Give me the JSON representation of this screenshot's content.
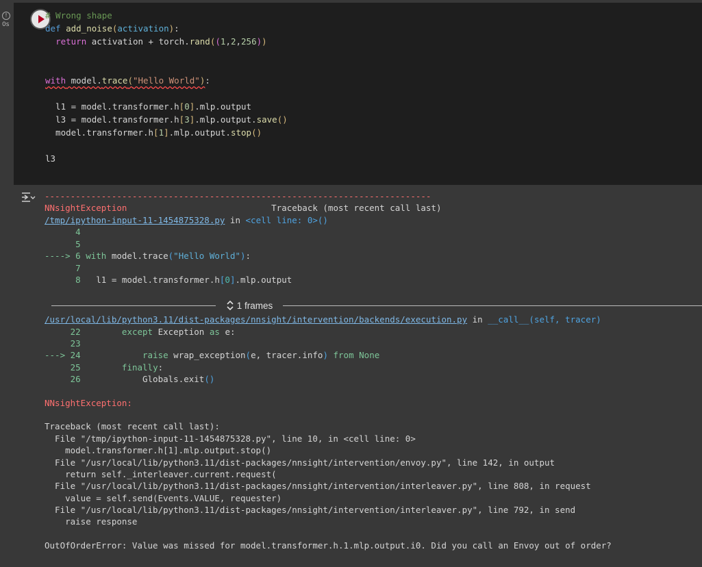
{
  "cell": {
    "status_time": "0s",
    "lines": [
      "# Wrong shape",
      "def add_noise(activation):",
      "  return activation + torch.rand((1,2,256))",
      "",
      "",
      "with model.trace(\"Hello World\"):",
      "",
      "  l1 = model.transformer.h[0].mlp.output",
      "  l3 = model.transformer.h[3].mlp.output.save()",
      "  model.transformer.h[1].mlp.output.stop()",
      "",
      "l3"
    ]
  },
  "output": {
    "dashes": "---------------------------------------------------------------------------",
    "exc_name": "NNsightException",
    "traceback_header": "Traceback (most recent call last)",
    "file1_link": "/tmp/ipython-input-11-1454875328.py",
    "file1_in": " in ",
    "file1_loc": "<cell line: 0>()",
    "file1_lines": [
      {
        "arrow": "      ",
        "num": "4",
        "code": ""
      },
      {
        "arrow": "      ",
        "num": "5",
        "code": ""
      },
      {
        "arrow": "----> ",
        "num": "6",
        "code": "with model.trace(\"Hello World\"):"
      },
      {
        "arrow": "      ",
        "num": "7",
        "code": ""
      },
      {
        "arrow": "      ",
        "num": "8",
        "code": "  l1 = model.transformer.h[0].mlp.output"
      }
    ],
    "frames_label": "1 frames",
    "file2_link": "/usr/local/lib/python3.11/dist-packages/nnsight/intervention/backends/execution.py",
    "file2_in": " in ",
    "file2_loc": "__call__(self, tracer)",
    "file2_lines": [
      {
        "arrow": "     ",
        "num": "22",
        "code": "        except Exception as e:"
      },
      {
        "arrow": "     ",
        "num": "23",
        "code": ""
      },
      {
        "arrow": "---> ",
        "num": "24",
        "code": "            raise wrap_exception(e, tracer.info) from None"
      },
      {
        "arrow": "     ",
        "num": "25",
        "code": "        finally:"
      },
      {
        "arrow": "     ",
        "num": "26",
        "code": "            Globals.exit()"
      }
    ],
    "exc_label": "NNsightException:",
    "tb_plain": [
      "Traceback (most recent call last):",
      "  File \"/tmp/ipython-input-11-1454875328.py\", line 10, in <cell line: 0>",
      "    model.transformer.h[1].mlp.output.stop()",
      "  File \"/usr/local/lib/python3.11/dist-packages/nnsight/intervention/envoy.py\", line 142, in output",
      "    return self._interleaver.current.request(",
      "  File \"/usr/local/lib/python3.11/dist-packages/nnsight/intervention/interleaver.py\", line 808, in request",
      "    value = self.send(Events.VALUE, requester)",
      "  File \"/usr/local/lib/python3.11/dist-packages/nnsight/intervention/interleaver.py\", line 792, in send",
      "    raise response"
    ],
    "final_error": "OutOfOrderError: Value was missed for model.transformer.h.1.mlp.output.i0. Did you call an Envoy out of order?"
  }
}
